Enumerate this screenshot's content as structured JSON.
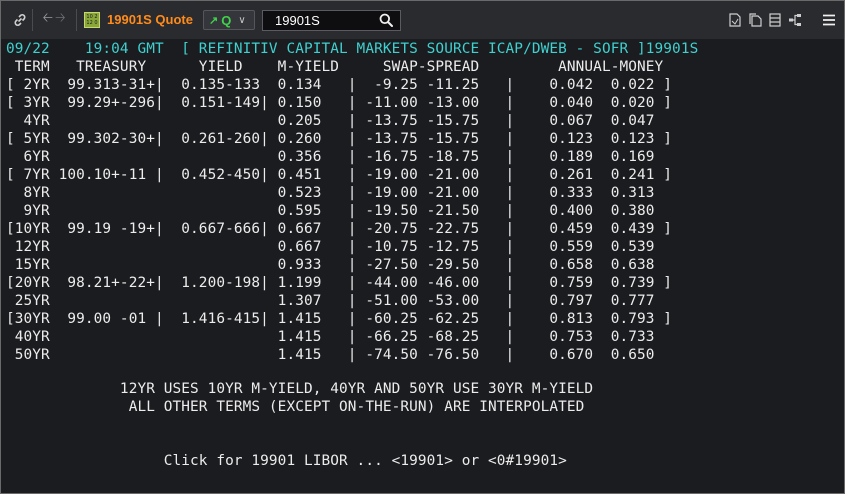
{
  "toolbar": {
    "app_badge": "10 2\n12 0",
    "title": "19901S Quote",
    "quote_button_label": "Q",
    "ric_value": "19901S",
    "right_icons": [
      "document-icon",
      "documents-icon",
      "list-icon",
      "hierarchy-icon",
      "menu-icon"
    ]
  },
  "screen": {
    "header_line": "09/22    19:04 GMT  [ REFINITIV CAPITAL MARKETS SOURCE ICAP/DWEB - SOFR ]19901S",
    "column_headers": " TERM   TREASURY      YIELD    M-YIELD     SWAP-SPREAD         ANNUAL-MONEY",
    "rows": [
      "[ 2YR  99.313-31+|  0.135-133  0.134   |  -9.25 -11.25   |    0.042  0.022 ]",
      "[ 3YR  99.29+-296|  0.151-149| 0.150   | -11.00 -13.00   |    0.040  0.020 ]",
      "  4YR                          0.205   | -13.75 -15.75   |    0.067  0.047",
      "[ 5YR  99.302-30+|  0.261-260| 0.260   | -13.75 -15.75   |    0.123  0.123 ]",
      "  6YR                          0.356   | -16.75 -18.75   |    0.189  0.169",
      "[ 7YR 100.10+-11 |  0.452-450| 0.451   | -19.00 -21.00   |    0.261  0.241 ]",
      "  8YR                          0.523   | -19.00 -21.00   |    0.333  0.313",
      "  9YR                          0.595   | -19.50 -21.50   |    0.400  0.380",
      "[10YR  99.19 -19+|  0.667-666| 0.667   | -20.75 -22.75   |    0.459  0.439 ]",
      " 12YR                          0.667   | -10.75 -12.75   |    0.559  0.539",
      " 15YR                          0.933   | -27.50 -29.50   |    0.658  0.638",
      "[20YR  98.21+-22+|  1.200-198| 1.199   | -44.00 -46.00   |    0.759  0.739 ]",
      " 25YR                          1.307   | -51.00 -53.00   |    0.797  0.777",
      "[30YR  99.00 -01 |  1.416-415| 1.415   | -60.25 -62.25   |    0.813  0.793 ]",
      " 40YR                          1.415   | -66.25 -68.25   |    0.753  0.733",
      " 50YR                          1.415   | -74.50 -76.50   |    0.670  0.650"
    ],
    "note_1": "             12YR USES 10YR M-YIELD, 40YR AND 50YR USE 30YR M-YIELD",
    "note_2": "              ALL OTHER TERMS (EXCEPT ON-THE-RUN) ARE INTERPOLATED",
    "footer_link": "                  Click for 19901 LIBOR ... <19901> or <0#19901>"
  }
}
